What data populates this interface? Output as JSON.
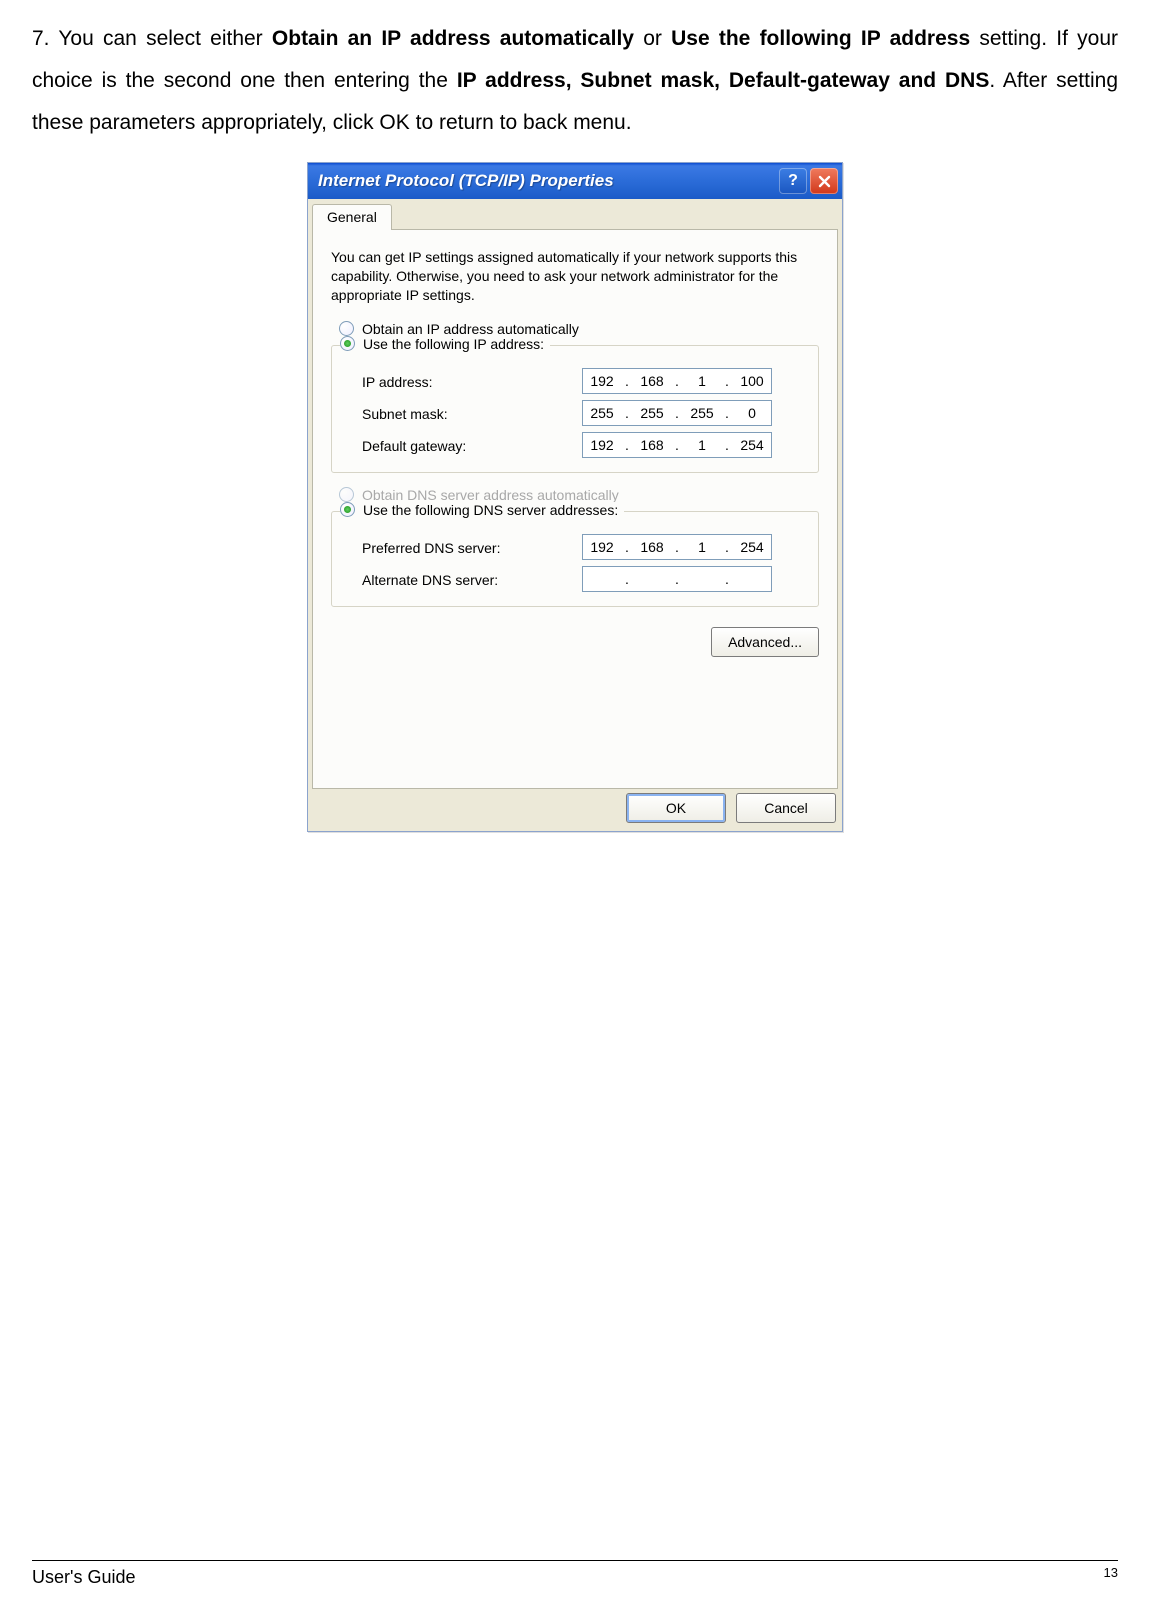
{
  "intro": {
    "p1": "7. You can select either ",
    "b1": "Obtain an IP address automatically",
    "p2": " or ",
    "b2": "Use the following IP address",
    "p3": " setting. If your choice is the second one then entering the ",
    "b3": "IP address, Subnet mask, Default-gateway and DNS",
    "p4": ". After setting these parameters appropriately, click OK to return to back menu."
  },
  "dialog": {
    "title": "Internet Protocol (TCP/IP) Properties",
    "help_glyph": "?",
    "tab_label": "General",
    "desc": "You can get IP settings assigned automatically if your network supports this capability. Otherwise, you need to ask your network administrator for the appropriate IP settings.",
    "radio_auto_ip": "Obtain an IP address automatically",
    "radio_static_ip": "Use the following IP address:",
    "ip_label": "IP address:",
    "subnet_label": "Subnet mask:",
    "gateway_label": "Default gateway:",
    "radio_auto_dns": "Obtain DNS server address automatically",
    "radio_static_dns": "Use the following DNS server addresses:",
    "pref_dns_label": "Preferred DNS server:",
    "alt_dns_label": "Alternate DNS server:",
    "ip": {
      "o1": "192",
      "o2": "168",
      "o3": "1",
      "o4": "100"
    },
    "subnet": {
      "o1": "255",
      "o2": "255",
      "o3": "255",
      "o4": "0"
    },
    "gateway": {
      "o1": "192",
      "o2": "168",
      "o3": "1",
      "o4": "254"
    },
    "pref_dns": {
      "o1": "192",
      "o2": "168",
      "o3": "1",
      "o4": "254"
    },
    "alt_dns": {
      "o1": "",
      "o2": "",
      "o3": "",
      "o4": ""
    },
    "advanced_label": "Advanced...",
    "ok_label": "OK",
    "cancel_label": "Cancel"
  },
  "footer": {
    "guide": "User's Guide",
    "page": "13"
  }
}
